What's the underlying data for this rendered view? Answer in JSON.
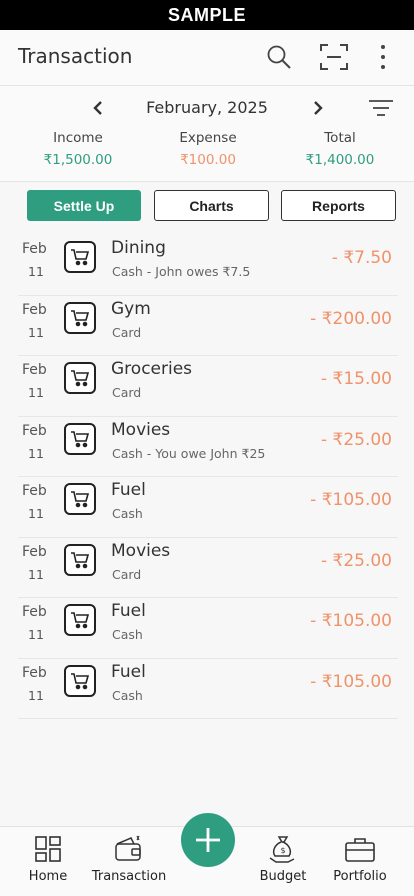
{
  "watermark": "SAMPLE",
  "header": {
    "title": "Transaction"
  },
  "month_nav": {
    "month": "February, 2025"
  },
  "summary": {
    "income_label": "Income",
    "income_value": "₹1,500.00",
    "expense_label": "Expense",
    "expense_value": "₹100.00",
    "total_label": "Total",
    "total_value": "₹1,400.00"
  },
  "tabs": {
    "settle": "Settle Up",
    "charts": "Charts",
    "reports": "Reports"
  },
  "transactions": [
    {
      "month": "Feb",
      "day": "11",
      "name": "Dining",
      "detail": "Cash - John owes ₹7.5",
      "amount": "- ₹7.50"
    },
    {
      "month": "Feb",
      "day": "11",
      "name": "Gym",
      "detail": "Card",
      "amount": "- ₹200.00"
    },
    {
      "month": "Feb",
      "day": "11",
      "name": "Groceries",
      "detail": "Card",
      "amount": "- ₹15.00"
    },
    {
      "month": "Feb",
      "day": "11",
      "name": "Movies",
      "detail": "Cash - You owe John ₹25",
      "amount": "- ₹25.00"
    },
    {
      "month": "Feb",
      "day": "11",
      "name": "Fuel",
      "detail": "Cash",
      "amount": "- ₹105.00"
    },
    {
      "month": "Feb",
      "day": "11",
      "name": "Movies",
      "detail": "Card",
      "amount": "- ₹25.00"
    },
    {
      "month": "Feb",
      "day": "11",
      "name": "Fuel",
      "detail": "Cash",
      "amount": "- ₹105.00"
    },
    {
      "month": "Feb",
      "day": "11",
      "name": "Fuel",
      "detail": "Cash",
      "amount": "- ₹105.00"
    }
  ],
  "bottom_nav": {
    "home": "Home",
    "transaction": "Transaction",
    "budget": "Budget",
    "portfolio": "Portfolio"
  },
  "colors": {
    "accent": "#2f9e80",
    "expense": "#f0926a",
    "income": "#2f9e80"
  },
  "icons": [
    "search-icon",
    "scan-icon",
    "more-vertical-icon",
    "chevron-left-icon",
    "chevron-right-icon",
    "filter-icon",
    "cart-icon",
    "grid-icon",
    "wallet-icon",
    "plus-icon",
    "money-bag-icon",
    "briefcase-icon"
  ]
}
